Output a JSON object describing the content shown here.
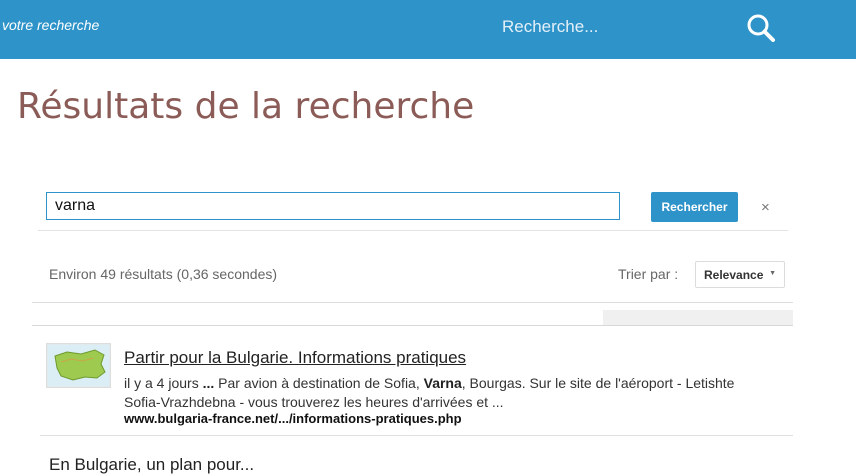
{
  "header": {
    "crumb": "votre recherche",
    "search_placeholder": "Recherche...",
    "search_icon": "search-icon",
    "bar_color": "#2e93c9"
  },
  "page": {
    "title": "Résultats de la recherche"
  },
  "search": {
    "query": "varna",
    "button_label": "Rechercher",
    "clear_label": "×"
  },
  "results_meta": {
    "count_text": "Environ 49 résultats (0,36 secondes)",
    "sort_label": "Trier par :",
    "sort_value": "Relevance"
  },
  "results": [
    {
      "title": "Partir pour la Bulgarie. Informations pratiques",
      "snippet_parts": [
        {
          "text": "il y a 4 jours ",
          "bold": false
        },
        {
          "text": "...",
          "bold": true
        },
        {
          "text": " Par avion à destination de Sofia, ",
          "bold": false
        },
        {
          "text": "Varna",
          "bold": true
        },
        {
          "text": ", Bourgas. Sur le site de l'aéroport - Letishte Sofia-Vrazhdebna - vous trouverez les heures d'arrivées et ...",
          "bold": false
        }
      ],
      "url": "www.bulgaria-france.net/.../informations-pratiques.php",
      "thumbnail": "bulgaria-map-thumbnail"
    },
    {
      "title": "En Bulgarie, un plan pour..."
    }
  ]
}
